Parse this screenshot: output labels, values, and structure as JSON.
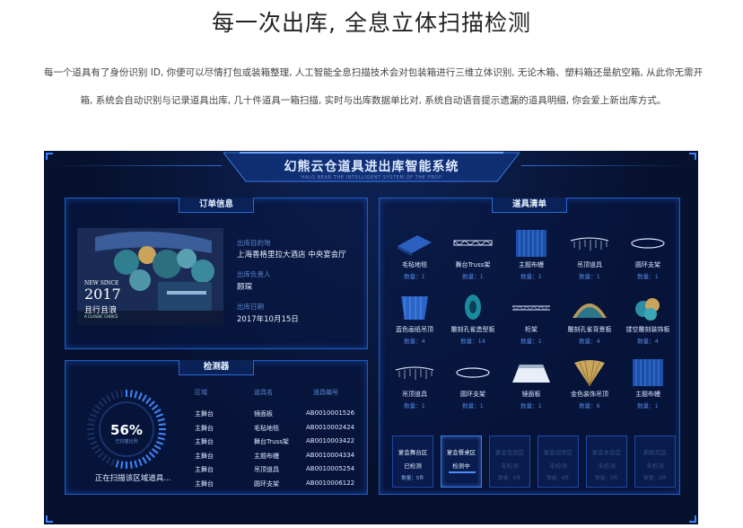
{
  "page": {
    "title": "每一次出库, 全息立体扫描检测",
    "intro": "每一个道具有了身份识别 ID, 你便可以尽情打包或装箱整理, 人工智能全息扫描技术会对包装箱进行三维立体识别, 无论木箱、塑料箱还是航空箱, 从此你无需开箱, 系统会自动识别与记录道具出库, 几十件道具一箱扫描, 实时与出库数据单比对, 系统自动语音提示遗漏的道具明细, 你会爱上新出库方式。"
  },
  "dashboard": {
    "title": "幻熊云仓道具进出库智能系统",
    "subtitle": "HALO BEAR THE INTELLIGENT SYSTEM OF THE PROP",
    "accent": "#1f5dc4",
    "background": "#06112e"
  },
  "order": {
    "tab": "订单信息",
    "image_caption": {
      "line1": "NEW SINCE",
      "year": "2017",
      "line3": "且行且浪",
      "line4": "A CLASSIC CHOICE"
    },
    "fields": [
      {
        "label": "出库目的地",
        "value": "上海香格里拉大酒店 中央宴会厅"
      },
      {
        "label": "出库负责人",
        "value": "顾琛"
      },
      {
        "label": "出库日期",
        "value": "2017年10月15日"
      }
    ]
  },
  "detector": {
    "tab": "检测器",
    "percent": "56%",
    "gauge_value": 0.56,
    "gauge_sub": "已扫描比例",
    "status": "正在扫描该区域道具...",
    "columns": [
      "区域",
      "道具名",
      "道具编号"
    ],
    "rows": [
      [
        "主舞台",
        "镜面板",
        "AB0010001526"
      ],
      [
        "主舞台",
        "毛毡地毯",
        "AB0010002424"
      ],
      [
        "主舞台",
        "舞台Truss架",
        "AB0010003422"
      ],
      [
        "主舞台",
        "主题布幔",
        "AB0010004334"
      ],
      [
        "主舞台",
        "吊顶道具",
        "AB0010005254"
      ],
      [
        "主舞台",
        "圆环支架",
        "AB0010006122"
      ]
    ]
  },
  "inventory": {
    "tab": "道具清单",
    "items": [
      {
        "name": "毛毡地毯",
        "qty": "数量：1",
        "icon": "carpet-icon"
      },
      {
        "name": "舞台Truss架",
        "qty": "数量：1",
        "icon": "truss-icon"
      },
      {
        "name": "主题布幔",
        "qty": "数量：1",
        "icon": "curtain-icon"
      },
      {
        "name": "吊顶道具",
        "qty": "数量：1",
        "icon": "ceiling-prop-icon"
      },
      {
        "name": "圆环支架",
        "qty": "数量：1",
        "icon": "ring-stand-icon"
      },
      {
        "name": "蓝色画纸吊顶",
        "qty": "数量：4",
        "icon": "blue-paper-icon"
      },
      {
        "name": "雕刻孔雀造型板",
        "qty": "数量：14",
        "icon": "peacock-board-icon"
      },
      {
        "name": "桁架",
        "qty": "数量：1",
        "icon": "frame-icon"
      },
      {
        "name": "雕刻孔雀背景板",
        "qty": "数量：4",
        "icon": "peacock-backdrop-icon"
      },
      {
        "name": "镂空雕刻装饰板",
        "qty": "数量：4",
        "icon": "carved-panel-icon"
      },
      {
        "name": "吊顶道具",
        "qty": "数量：1",
        "icon": "ceiling-prop-icon"
      },
      {
        "name": "圆环支架",
        "qty": "数量：1",
        "icon": "ring-stand-icon"
      },
      {
        "name": "镜面板",
        "qty": "数量：1",
        "icon": "mirror-icon"
      },
      {
        "name": "金色装饰吊顶",
        "qty": "数量：6",
        "icon": "gold-fan-icon"
      },
      {
        "name": "主题布幔",
        "qty": "数量：1",
        "icon": "curtain-icon"
      }
    ],
    "zones": [
      {
        "name": "宴会舞台区",
        "status": "已检测",
        "count": "数量：5件",
        "state": "on",
        "active": false
      },
      {
        "name": "宴会餐桌区",
        "status": "检测中",
        "count": "",
        "state": "on",
        "active": true
      },
      {
        "name": "宴会签到区",
        "status": "未检测",
        "count": "数量：5件",
        "state": "off",
        "active": false
      },
      {
        "name": "宴会迎宾区",
        "status": "未检测",
        "count": "数量：4件",
        "state": "off",
        "active": false
      },
      {
        "name": "宴会休息区",
        "status": "未检测",
        "count": "数量：3件",
        "state": "off",
        "active": false
      },
      {
        "name": "新娘房区",
        "status": "未检测",
        "count": "数量：2件",
        "state": "off",
        "active": false
      }
    ]
  }
}
